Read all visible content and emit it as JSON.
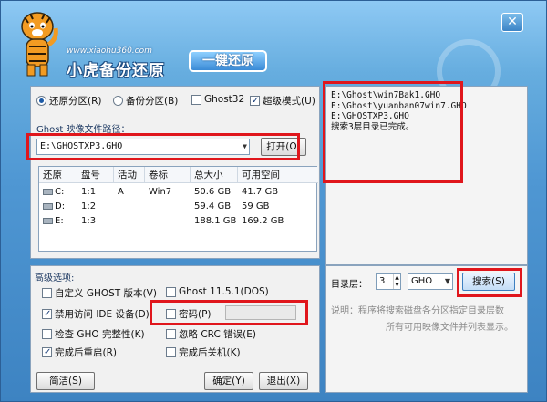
{
  "app": {
    "site": "www.xiaohu360.com",
    "title": "小虎备份还原",
    "badge": "一键还原",
    "close_label": "✕"
  },
  "modes": {
    "restore": "还原分区(R)",
    "backup": "备份分区(B)",
    "ghost32": "Ghost32",
    "super": "超级模式(U)"
  },
  "path": {
    "label": "Ghost 映像文件路径：",
    "value": "E:\\GHOSTXP3.GHO",
    "open_button": "打开(O)"
  },
  "table": {
    "headers": [
      "还原",
      "盘号",
      "活动",
      "卷标",
      "总大小",
      "可用空间"
    ],
    "rows": [
      [
        "C:",
        "1:1",
        "A",
        "Win7",
        "50.6 GB",
        "41.7 GB"
      ],
      [
        "D:",
        "1:2",
        "",
        "",
        "59.4 GB",
        "59 GB"
      ],
      [
        "E:",
        "1:3",
        "",
        "",
        "188.1 GB",
        "169.2 GB"
      ]
    ]
  },
  "log": {
    "lines": [
      "E:\\Ghost\\win7Bak1.GHO",
      "E:\\Ghost\\yuanban07win7.GHO",
      "E:\\GHOSTXP3.GHO",
      "搜索3层目录已完成。"
    ]
  },
  "advanced": {
    "title": "高级选项:",
    "custom_ghost": "自定义 GHOST 版本(V)",
    "ghost_version": "Ghost 11.5.1(DOS)",
    "disable_ide": "禁用访问 IDE 设备(D)",
    "password": "密码(P)",
    "check_gho": "检查 GHO 完整性(K)",
    "ignore_crc": "忽略 CRC 错误(E)",
    "restart": "完成后重启(R)",
    "shutdown": "完成后关机(K)"
  },
  "search": {
    "depth_label": "目录层：",
    "depth_value": "3",
    "ext_value": "GHO",
    "search_button": "搜索(S)",
    "note_line1": "说明：程序将搜索磁盘各分区指定目录层数",
    "note_line2": "所有可用映像文件并列表显示。"
  },
  "footer": {
    "mini": "简洁(S)",
    "ok": "确定(Y)",
    "exit": "退出(X)"
  },
  "colors": {
    "highlight": "#e0161c",
    "window_blue": "#4f97d3"
  }
}
